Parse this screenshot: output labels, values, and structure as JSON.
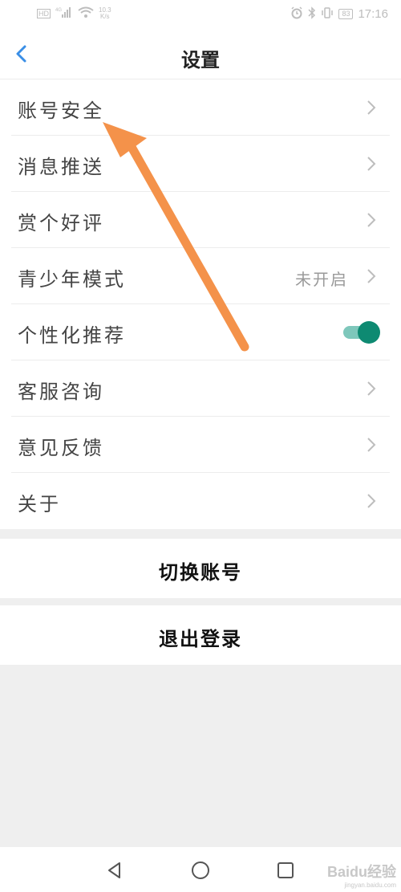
{
  "status_bar": {
    "network_speed": "10.3",
    "network_unit": "K/s",
    "signal_labels": [
      "HD",
      "4G"
    ],
    "battery": "83",
    "time": "17:16"
  },
  "header": {
    "title": "设置"
  },
  "settings": {
    "items": [
      {
        "label": "账号安全"
      },
      {
        "label": "消息推送"
      },
      {
        "label": "赏个好评"
      },
      {
        "label": "青少年模式",
        "value": "未开启"
      },
      {
        "label": "个性化推荐",
        "toggle": true
      },
      {
        "label": "客服咨询"
      },
      {
        "label": "意见反馈"
      },
      {
        "label": "关于"
      }
    ]
  },
  "actions": {
    "switch_account": "切换账号",
    "logout": "退出登录"
  },
  "watermark": {
    "text": "Baidu经验",
    "sub": "jingyan.baidu.com"
  },
  "colors": {
    "accent_blue": "#3a8ee6",
    "toggle_on": "#0e8a72",
    "annotation_arrow": "#f4924a",
    "background": "#efefef"
  },
  "icons": {
    "back": "chevron-left-icon",
    "row_arrow": "chevron-right-icon",
    "sys_back": "triangle-back-icon",
    "sys_home": "circle-home-icon",
    "sys_recent": "square-recent-icon"
  }
}
